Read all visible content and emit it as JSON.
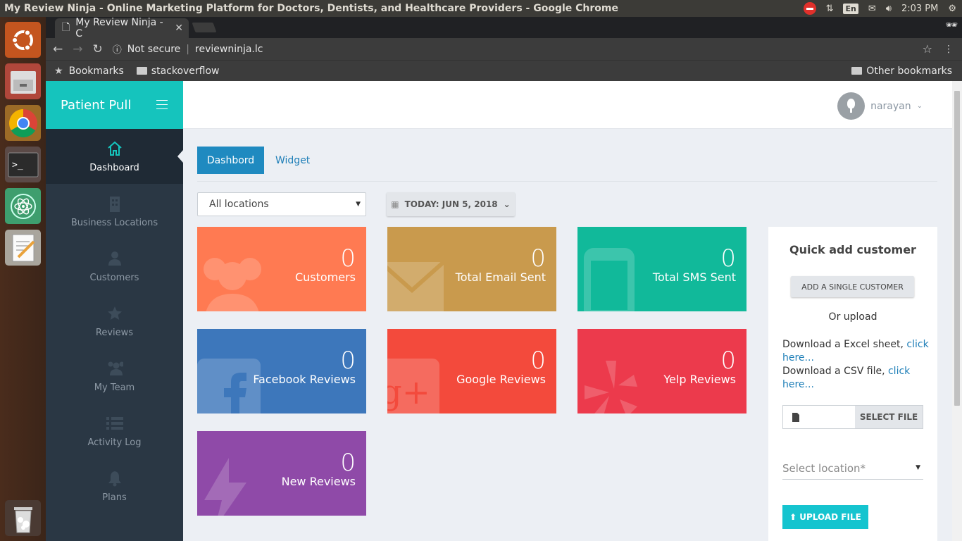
{
  "os": {
    "window_title": "My Review Ninja - Online Marketing Platform for Doctors, Dentists, and Healthcare Providers - Google Chrome",
    "keyboard_lang": "En",
    "clock": "2:03 PM"
  },
  "launcher": {
    "apps": [
      "ubuntu-icon",
      "files-icon",
      "chrome-icon",
      "terminal-icon",
      "atom-icon",
      "text-editor-icon",
      "trash-icon"
    ]
  },
  "browser": {
    "tab_title": "My Review Ninja - C",
    "security_label": "Not secure",
    "url": "reviewninja.lc",
    "bookmarks_label": "Bookmarks",
    "bookmark_folder": "stackoverflow",
    "other_bookmarks": "Other bookmarks"
  },
  "app": {
    "brand": "Patient Pull",
    "user_name": "narayan",
    "nav": [
      {
        "label": "Dashboard",
        "icon": "home-icon",
        "active": true
      },
      {
        "label": "Business Locations",
        "icon": "building-icon",
        "active": false
      },
      {
        "label": "Customers",
        "icon": "user-icon",
        "active": false
      },
      {
        "label": "Reviews",
        "icon": "star-icon",
        "active": false
      },
      {
        "label": "My Team",
        "icon": "users-icon",
        "active": false
      },
      {
        "label": "Activity Log",
        "icon": "list-icon",
        "active": false
      },
      {
        "label": "Plans",
        "icon": "bell-icon",
        "active": false
      }
    ],
    "tabs": {
      "dashboard": "Dashbord",
      "widget": "Widget"
    },
    "location_select": "All locations",
    "date_button": "TODAY: JUN 5, 2018",
    "cards": [
      {
        "value": "0",
        "label": "Customers",
        "color": "#ff7a52",
        "icon": "users-icon"
      },
      {
        "value": "0",
        "label": "Total Email Sent",
        "color": "#c99a4d",
        "icon": "envelope-icon"
      },
      {
        "value": "0",
        "label": "Total SMS Sent",
        "color": "#11b99a",
        "icon": "mobile-icon"
      },
      {
        "value": "0",
        "label": "Facebook Reviews",
        "color": "#3d77bb",
        "icon": "facebook-icon"
      },
      {
        "value": "0",
        "label": "Google Reviews",
        "color": "#f34a3c",
        "icon": "google-plus-icon"
      },
      {
        "value": "0",
        "label": "Yelp Reviews",
        "color": "#ec3a4c",
        "icon": "yelp-icon"
      },
      {
        "value": "0",
        "label": "New Reviews",
        "color": "#8f4aa8",
        "icon": "bolt-icon"
      }
    ],
    "quick_add": {
      "title": "Quick add customer",
      "add_single": "ADD A SINGLE CUSTOMER",
      "or_upload": "Or upload",
      "excel_text": "Download a Excel sheet, ",
      "csv_text": "Download a CSV file, ",
      "click_here": "click here...",
      "select_file": "SELECT FILE",
      "select_location": "Select location*",
      "upload_file": "UPLOAD FILE"
    }
  }
}
